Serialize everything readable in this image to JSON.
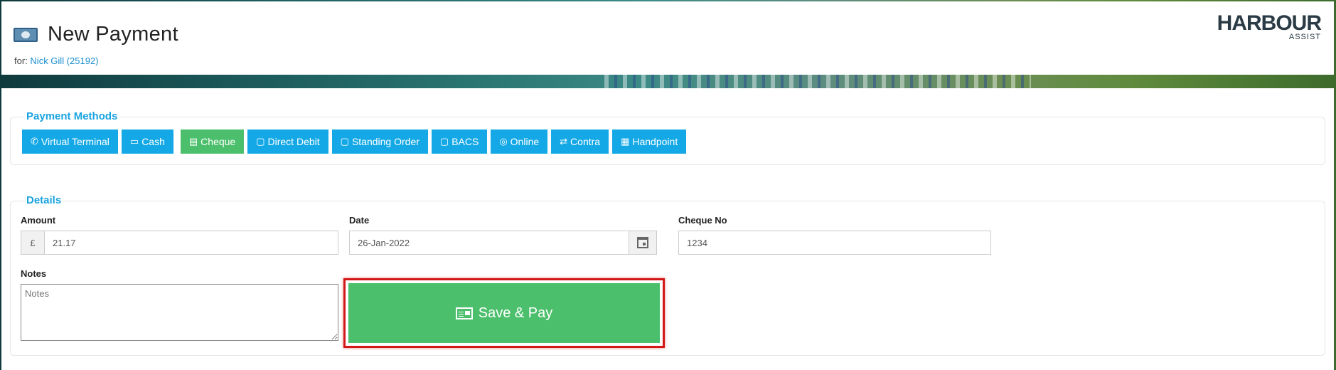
{
  "header": {
    "title": "New Payment",
    "for_label": "for:",
    "customer_link": "Nick Gill (25192)",
    "logo_main": "HARBOUR",
    "logo_sub": "ASSIST"
  },
  "payment_methods": {
    "legend": "Payment Methods",
    "buttons": [
      {
        "label": "Virtual Terminal",
        "icon": "phone-icon"
      },
      {
        "label": "Cash",
        "icon": "money-icon"
      },
      {
        "label": "Cheque",
        "icon": "cheque-icon",
        "active": true
      },
      {
        "label": "Direct Debit",
        "icon": "calendar-icon"
      },
      {
        "label": "Standing Order",
        "icon": "calendar-icon"
      },
      {
        "label": "BACS",
        "icon": "calendar-icon"
      },
      {
        "label": "Online",
        "icon": "globe-icon"
      },
      {
        "label": "Contra",
        "icon": "exchange-icon"
      },
      {
        "label": "Handpoint",
        "icon": "calculator-icon"
      }
    ]
  },
  "details": {
    "legend": "Details",
    "amount_label": "Amount",
    "currency_symbol": "£",
    "amount_value": "21.17",
    "date_label": "Date",
    "date_value": "26-Jan-2022",
    "cheque_label": "Cheque No",
    "cheque_value": "1234",
    "notes_label": "Notes",
    "notes_placeholder": "Notes",
    "save_label": "Save & Pay"
  },
  "colors": {
    "primary": "#14a9e6",
    "success": "#4bbf6b",
    "highlight": "#d21818"
  }
}
